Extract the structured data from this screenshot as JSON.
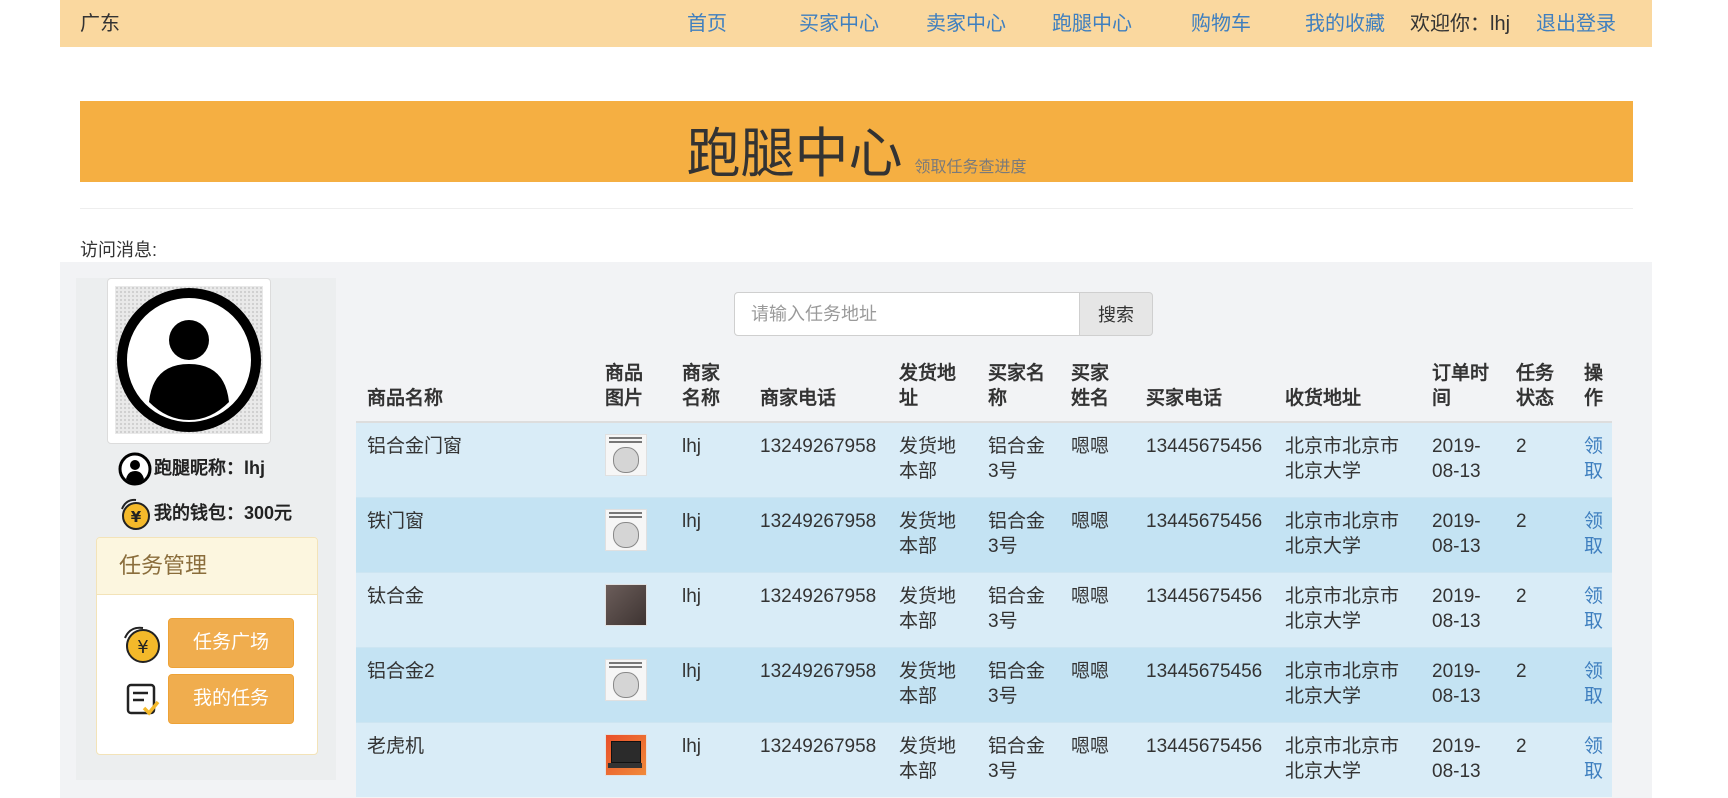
{
  "navbar": {
    "region": "广东",
    "links": [
      "首页",
      "买家中心",
      "卖家中心",
      "跑腿中心",
      "购物车",
      "我的收藏"
    ],
    "welcome_prefix": "欢迎你：",
    "username": "lhj",
    "logout": "退出登录"
  },
  "banner": {
    "title": "跑腿中心",
    "subtitle": "领取任务查进度"
  },
  "visit_label": "访问消息:",
  "profile": {
    "nickname_label": "跑腿昵称：",
    "nickname": "lhj",
    "wallet_label": "我的钱包：",
    "wallet": "300元"
  },
  "task_panel": {
    "title": "任务管理",
    "square_btn": "任务广场",
    "my_tasks_btn": "我的任务"
  },
  "search": {
    "placeholder": "请输入任务地址",
    "button": "搜索"
  },
  "table": {
    "headers": [
      "商品名称",
      "商品图片",
      "商家名称",
      "商家电话",
      "发货地址",
      "买家名称",
      "买家姓名",
      "买家电话",
      "收货地址",
      "订单时间",
      "任务状态",
      "操作"
    ],
    "rows": [
      {
        "name": "铝合金门窗",
        "image": "meme",
        "merchant": "lhj",
        "merchant_phone": "13249267958",
        "ship_addr": "发货地本部",
        "buyer_name": "铝合金3号",
        "buyer_real": "嗯嗯",
        "buyer_phone": "13445675456",
        "recv_addr": "北京市北京市北京大学",
        "date": "2019-08-13",
        "status": "2",
        "op": "领取"
      },
      {
        "name": "铁门窗",
        "image": "meme",
        "merchant": "lhj",
        "merchant_phone": "13249267958",
        "ship_addr": "发货地本部",
        "buyer_name": "铝合金3号",
        "buyer_real": "嗯嗯",
        "buyer_phone": "13445675456",
        "recv_addr": "北京市北京市北京大学",
        "date": "2019-08-13",
        "status": "2",
        "op": "领取"
      },
      {
        "name": "钛合金",
        "image": "box",
        "merchant": "lhj",
        "merchant_phone": "13249267958",
        "ship_addr": "发货地本部",
        "buyer_name": "铝合金3号",
        "buyer_real": "嗯嗯",
        "buyer_phone": "13445675456",
        "recv_addr": "北京市北京市北京大学",
        "date": "2019-08-13",
        "status": "2",
        "op": "领取"
      },
      {
        "name": "铝合金2",
        "image": "meme",
        "merchant": "lhj",
        "merchant_phone": "13249267958",
        "ship_addr": "发货地本部",
        "buyer_name": "铝合金3号",
        "buyer_real": "嗯嗯",
        "buyer_phone": "13445675456",
        "recv_addr": "北京市北京市北京大学",
        "date": "2019-08-13",
        "status": "2",
        "op": "领取"
      },
      {
        "name": "老虎机",
        "image": "laptop",
        "merchant": "lhj",
        "merchant_phone": "13249267958",
        "ship_addr": "发货地本部",
        "buyer_name": "铝合金3号",
        "buyer_real": "嗯嗯",
        "buyer_phone": "13445675456",
        "recv_addr": "北京市北京市北京大学",
        "date": "2019-08-13",
        "status": "2",
        "op": "领取"
      }
    ]
  },
  "icons": {
    "avatar": "user-avatar-icon",
    "nickname": "user-icon",
    "wallet": "yuan-coin-icon",
    "square": "yuan-coin-icon",
    "my_tasks": "task-list-icon"
  },
  "colors": {
    "navbar": "#fad89f",
    "banner": "#f5af42",
    "button": "#f0ad4e",
    "link": "#3f7fbf",
    "row_a": "#d9ecf7",
    "row_b": "#c4e3f3"
  }
}
